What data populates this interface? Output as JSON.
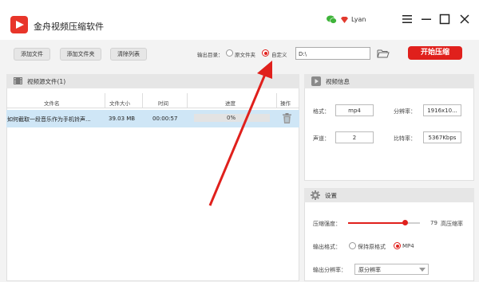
{
  "app": {
    "title": "金舟视频压缩软件"
  },
  "user": {
    "name": "Lyan"
  },
  "toolbar": {
    "add_file": "添加文件",
    "add_folder": "添加文件夹",
    "clear_list": "清除列表",
    "output_dir_label": "输出目录：",
    "option_source_folder": "原文件夹",
    "option_custom": "自定义",
    "selected_option": "自定义",
    "output_path": "D:\\",
    "start_button": "开始压缩"
  },
  "source_files": {
    "title": "视频源文件(1)",
    "columns": [
      "文件名",
      "文件大小",
      "时间",
      "进度",
      "操作"
    ],
    "rows": [
      {
        "name": "如何截取一段音乐作为手机铃声...",
        "size": "39.03 MB",
        "duration": "00:00:57",
        "progress": "0%"
      }
    ]
  },
  "video_info": {
    "title": "视频信息",
    "format_label": "格式：",
    "format_value": "mp4",
    "resolution_label": "分辨率：",
    "resolution_value": "1916x10...",
    "channel_label": "声道：",
    "channel_value": "2",
    "bitrate_label": "比特率：",
    "bitrate_value": "5367Kbps"
  },
  "settings": {
    "title": "设置",
    "strength_label": "压缩强度：",
    "strength_value": "79",
    "strength_fraction": 0.79,
    "strength_mode": "高压缩率",
    "output_format_label": "输出格式：",
    "format_keep": "保持原格式",
    "format_mp4": "MP4",
    "selected_format": "MP4",
    "output_resolution_label": "输出分辨率：",
    "output_resolution_value": "原分辨率"
  },
  "colors": {
    "accent": "#e0201c",
    "selection": "#cfe6f6"
  },
  "icons": [
    "app-logo-icon",
    "wechat-icon",
    "vip-badge-icon",
    "menu-icon",
    "minimize-icon",
    "maximize-icon",
    "close-icon",
    "folder-open-icon",
    "film-icon",
    "trash-icon",
    "gear-icon"
  ]
}
